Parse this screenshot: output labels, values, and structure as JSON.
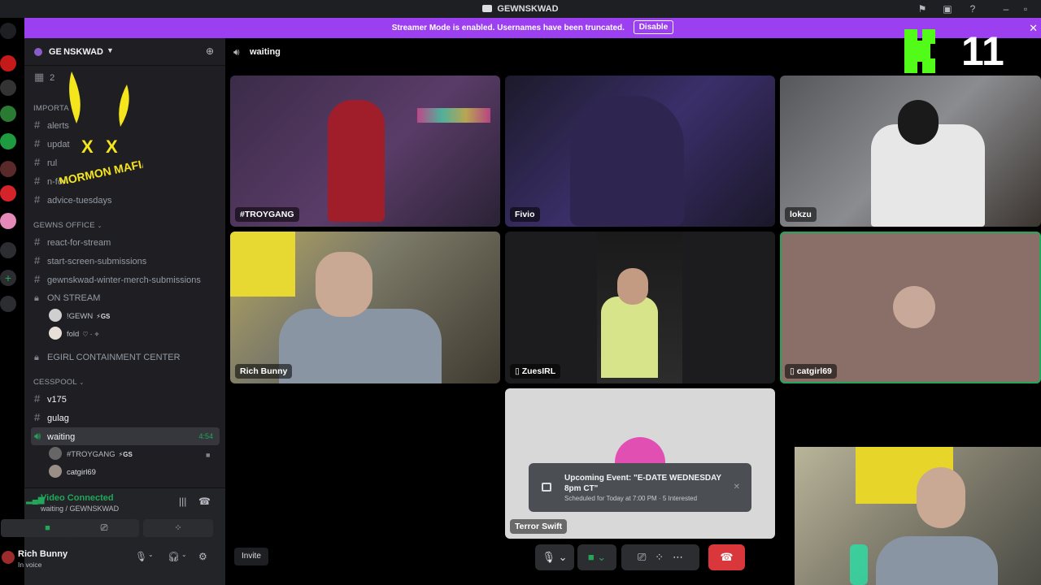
{
  "window": {
    "title": "GEWNSKWAD"
  },
  "banner": {
    "text": "Streamer Mode is enabled. Usernames have been truncated.",
    "button": "Disable"
  },
  "server": {
    "name": "GE NSKWAD",
    "events_count": "2"
  },
  "sidebar": {
    "rows": [
      {
        "type": "cat",
        "label": "IMPORTA"
      },
      {
        "type": "text",
        "label": "alerts"
      },
      {
        "type": "text",
        "label": "updat"
      },
      {
        "type": "text",
        "label": "rul"
      },
      {
        "type": "text",
        "label": "n-for-"
      },
      {
        "type": "text",
        "label": "advice-tuesdays"
      },
      {
        "type": "cat",
        "label": "GEWNS OFFICE"
      },
      {
        "type": "text",
        "label": "react-for-stream"
      },
      {
        "type": "text",
        "label": "start-screen-submissions"
      },
      {
        "type": "text",
        "label": "gewnskwad-winter-merch-submissions"
      },
      {
        "type": "locked",
        "label": "ON STREAM"
      },
      {
        "type": "locked",
        "label": "EGIRL CONTAINMENT CENTER"
      },
      {
        "type": "cat",
        "label": "CESSPOOL"
      },
      {
        "type": "text",
        "label": "v175"
      },
      {
        "type": "text",
        "label": "gulag"
      },
      {
        "type": "voice",
        "label": "waiting",
        "time": "4:54"
      }
    ],
    "on_stream_members": [
      {
        "name": "!GEWN",
        "tag": "⚡GS"
      },
      {
        "name": "fold",
        "tag": "♡ · ✧"
      }
    ],
    "waiting_members": [
      {
        "name": "#TROYGANG",
        "tag": "⚡GS"
      },
      {
        "name": "catgirl69",
        "tag": ""
      }
    ]
  },
  "voice_panel": {
    "status": "Video Connected",
    "location": "waiting / GEWNSKWAD"
  },
  "user_panel": {
    "name": "Rich Bunny",
    "status": "In voice"
  },
  "overlay": {
    "logo_text": "MORMON MAFIA"
  },
  "main": {
    "channel": "waiting",
    "tiles": [
      {
        "name": "#TROYGANG",
        "bg": "#3a2b45",
        "mobile": false
      },
      {
        "name": "Fivio",
        "bg": "#2a2440",
        "mobile": false
      },
      {
        "name": "lokzu",
        "bg": "#4a4a4e",
        "mobile": false
      },
      {
        "name": "Rich Bunny",
        "bg": "#6e6a58",
        "mobile": false
      },
      {
        "name": "ZuesIRL",
        "bg": "#1c1c1e",
        "mobile": true
      },
      {
        "name": "catgirl69",
        "bg": "#8a6f68",
        "mobile": true
      },
      {
        "name": "Terror Swift",
        "bg": "#d8d8d8",
        "mobile": false
      }
    ],
    "invite": "Invite"
  },
  "event": {
    "title": "Upcoming Event: \"E-DATE WEDNESDAY 8pm CT\"",
    "meta": "Scheduled for Today at 7:00 PM · 5 Interested"
  },
  "kick": {
    "count": "11"
  },
  "colors": {
    "accent": "#9b3ff0",
    "green": "#23a55a",
    "kick": "#53fc18",
    "danger": "#da373c"
  }
}
